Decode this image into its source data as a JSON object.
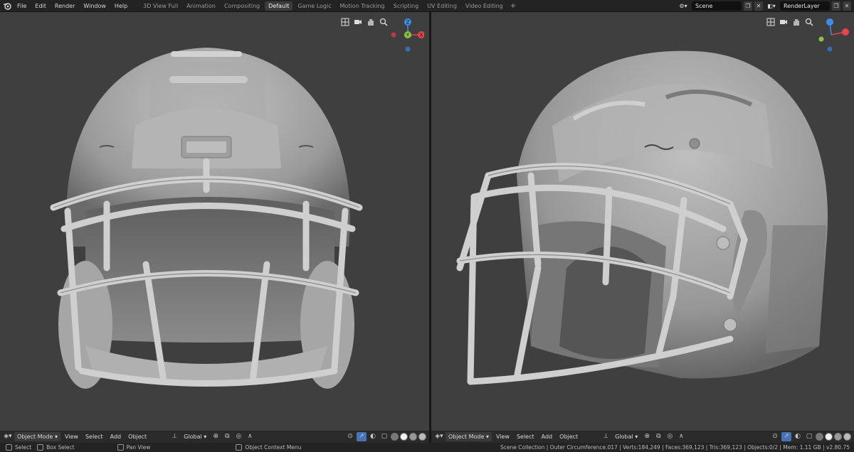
{
  "menu": [
    "File",
    "Edit",
    "Render",
    "Window",
    "Help"
  ],
  "workspace_tabs": [
    "3D View Full",
    "Animation",
    "Compositing",
    "Default",
    "Game Logic",
    "Motion Tracking",
    "Scripting",
    "UV Editing",
    "Video Editing"
  ],
  "active_tab": "Default",
  "add_tab_label": "+",
  "scene": {
    "value": "Scene"
  },
  "render_layer": {
    "value": "RenderLayer"
  },
  "viewport_header": {
    "mode": "Object Mode",
    "menus": [
      "View",
      "Select",
      "Add",
      "Object"
    ],
    "orientation": "Global"
  },
  "gizmo": {
    "z": "Z",
    "y": "Y",
    "x": "X"
  },
  "status": {
    "select": "Select",
    "box_select": "Box Select",
    "pan_view": "Pan View",
    "context_menu": "Object Context Menu",
    "stats": "Scene Collection | Outer Circumference.017 | Verts:184,249 | Faces:369,123 | Tris:369,123 | Objects:0/2 | Mem: 1.11 GB | v2.80.75"
  },
  "colors": {
    "viewport_bg": "#3f3f3f",
    "helmet": "#a8a8a8",
    "axis_x": "#e8434f",
    "axis_y": "#8bc34a",
    "axis_z": "#3e8ee8"
  }
}
